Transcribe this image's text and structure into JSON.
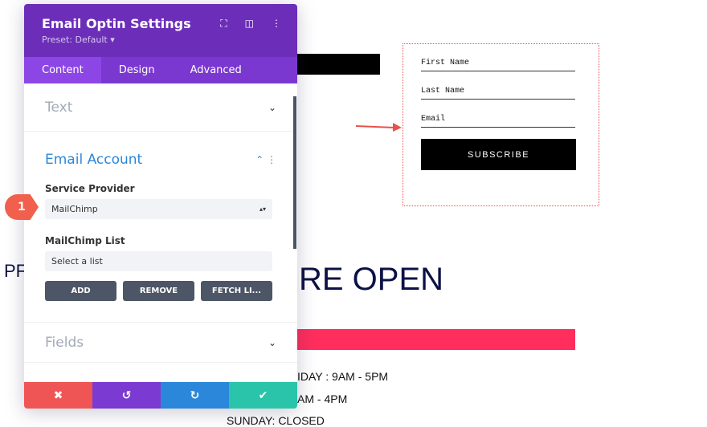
{
  "panel": {
    "title": "Email Optin Settings",
    "preset": "Preset: Default ▾",
    "tabs": [
      "Content",
      "Design",
      "Advanced"
    ],
    "sections": {
      "text": "Text",
      "email_account": "Email Account",
      "fields": "Fields"
    },
    "service_provider_label": "Service Provider",
    "service_provider_value": "MailChimp",
    "list_label": "MailChimp List",
    "list_value": "Select a list",
    "buttons": [
      "ADD",
      "REMOVE",
      "FETCH LI..."
    ]
  },
  "badge": "1",
  "form": {
    "fields": [
      "First Name",
      "Last Name",
      "Email"
    ],
    "submit": "SUBSCRIBE"
  },
  "page": {
    "heading_left": "PF",
    "heading_right": "RE OPEN",
    "hours": [
      "IDAY : 9AM - 5PM",
      "AM - 4PM",
      "SUNDAY: CLOSED"
    ]
  },
  "colors": {
    "header": "#6c2eb9",
    "cancel": "#ef5555",
    "undo": "#7b3ad1",
    "redo": "#2b87da",
    "save": "#29c4a9",
    "accent": "#ff2e5d"
  }
}
